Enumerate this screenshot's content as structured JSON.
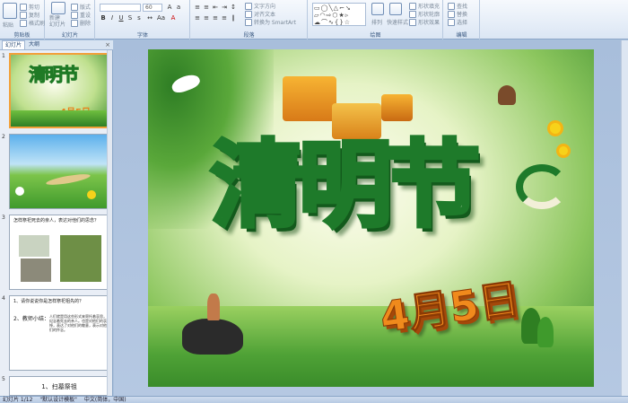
{
  "ribbon": {
    "groups": [
      {
        "key": "clipboard",
        "label": "剪贴板"
      },
      {
        "key": "slides",
        "label": "幻灯片"
      },
      {
        "key": "font",
        "label": "字体"
      },
      {
        "key": "paragraph",
        "label": "段落"
      },
      {
        "key": "drawing",
        "label": "绘图"
      },
      {
        "key": "editing",
        "label": "编辑"
      }
    ],
    "paste": "粘贴",
    "cut": "剪切",
    "copy": "复制",
    "format_painter": "格式刷",
    "new_slide": "新建\n幻灯片",
    "layout": "版式",
    "reset": "重设",
    "delete": "删除",
    "font_size": "60",
    "text_direction": "文字方向",
    "align_text": "对齐文本",
    "smartart": "转换为 SmartArt",
    "arrange": "排列",
    "quick_styles": "快速样式",
    "shape_fill": "形状填充",
    "shape_outline": "形状轮廓",
    "shape_effects": "形状效果",
    "find": "查找",
    "replace": "替换",
    "select": "选择"
  },
  "pane": {
    "tab_slides": "幻灯片",
    "tab_outline": "大纲",
    "close": "×",
    "thumbnails": [
      {
        "num": "1",
        "title": "清明节",
        "date": "4月5日"
      },
      {
        "num": "2"
      },
      {
        "num": "3",
        "text": "怎样祭祀死去的亲人，表达对他们的思念？"
      },
      {
        "num": "4",
        "q": "1、请你说说你是怎样祭祀祖先的？",
        "t2": "2、教师小结：",
        "t2body": "人们就是用这些形式来寄托着哀思，纪念着死去的亲人。也是对他们的哀悼，表达了对他们的敬意，表示对他们的怀念。"
      },
      {
        "num": "5",
        "text": "1、扫墓祭祖"
      }
    ]
  },
  "slide": {
    "title": "清明节",
    "date": "4月5日"
  },
  "status": {
    "slide_info": "幻灯片 1/12",
    "theme": "\"默认设计模板\"",
    "lang": "中文(简体，中国)"
  },
  "colors": {
    "accent": "#2d8a2e",
    "date": "#e8801a",
    "ribbon_bg": "#dbe6f4"
  }
}
